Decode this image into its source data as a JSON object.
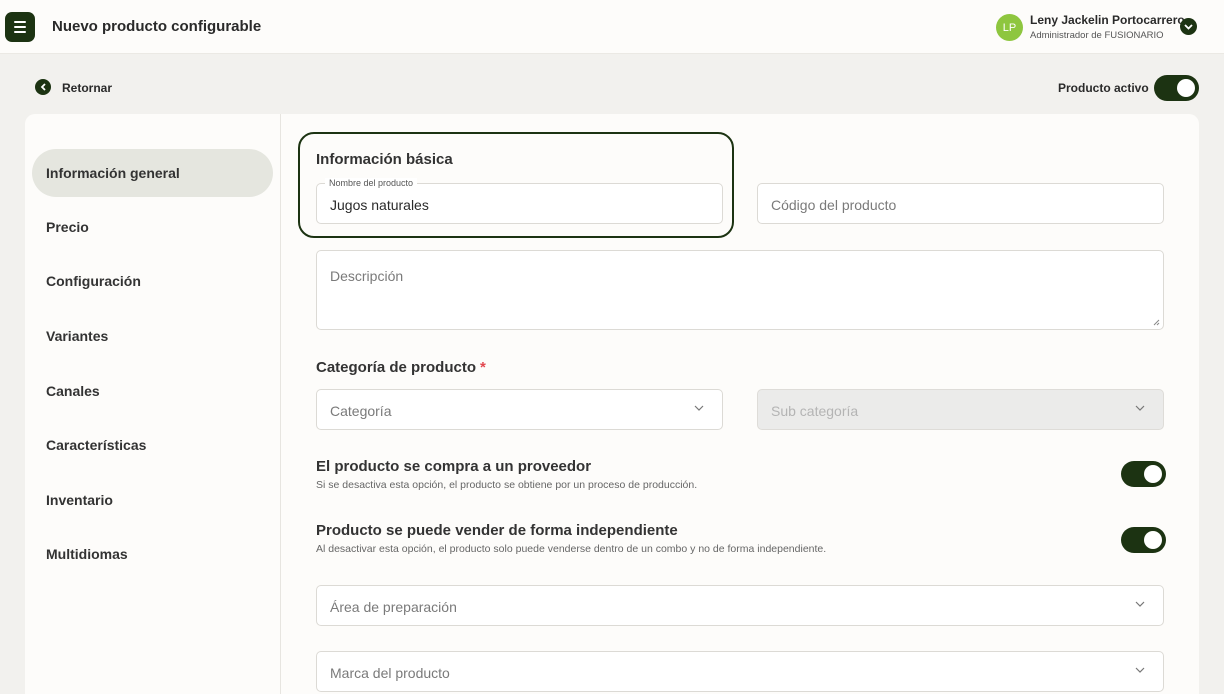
{
  "header": {
    "title": "Nuevo producto configurable",
    "user": {
      "initials": "LP",
      "name": "Leny Jackelin Portocarrero",
      "role": "Administrador de FUSIONARIO"
    }
  },
  "subheader": {
    "back_label": "Retornar",
    "active_label": "Producto activo",
    "active": true
  },
  "sidebar": {
    "items": [
      {
        "label": "Información general",
        "active": true
      },
      {
        "label": "Precio"
      },
      {
        "label": "Configuración"
      },
      {
        "label": "Variantes"
      },
      {
        "label": "Canales"
      },
      {
        "label": "Características"
      },
      {
        "label": "Inventario"
      },
      {
        "label": "Multidiomas"
      }
    ]
  },
  "form": {
    "basic_title": "Información básica",
    "product_name": {
      "label": "Nombre del producto",
      "value": "Jugos naturales"
    },
    "product_code": {
      "placeholder": "Código del producto"
    },
    "description": {
      "placeholder": "Descripción"
    },
    "category_title": "Categoría de producto",
    "required_mark": "*",
    "category": {
      "placeholder": "Categoría"
    },
    "subcategory": {
      "placeholder": "Sub categoría",
      "disabled": true
    },
    "supplier": {
      "title": "El producto se compra a un proveedor",
      "desc": "Si se desactiva esta opción, el producto se obtiene por un proceso de producción.",
      "enabled": true
    },
    "independent": {
      "title": "Producto se puede vender de forma independiente",
      "desc": "Al desactivar esta opción, el producto solo puede venderse dentro de un combo y no de forma independiente.",
      "enabled": true
    },
    "prep_area": {
      "placeholder": "Área de preparación"
    },
    "brand": {
      "placeholder": "Marca del producto"
    }
  },
  "colors": {
    "accent": "#1c3312",
    "avatar": "#8ec63f",
    "required": "#e2474f"
  }
}
